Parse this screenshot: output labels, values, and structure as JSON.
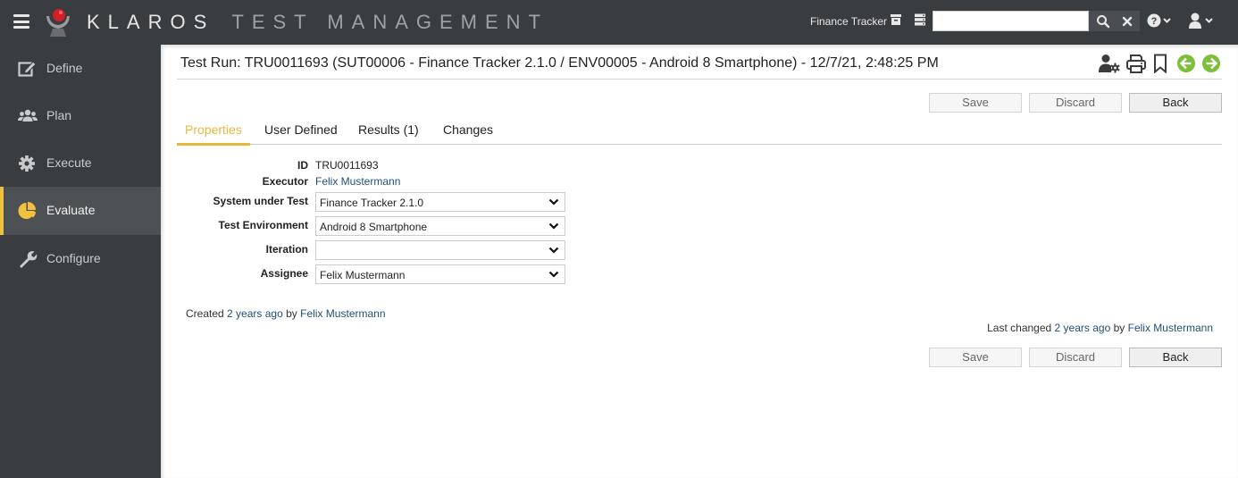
{
  "app": {
    "brand_primary": "KLAROS",
    "brand_secondary": "TEST MANAGEMENT",
    "accent_color": "#f0c040"
  },
  "topbar": {
    "project_name": "Finance Tracker",
    "search": {
      "value": "",
      "placeholder": ""
    },
    "icons": [
      "archive-icon",
      "server-icon",
      "search-icon",
      "clear-icon",
      "help-icon",
      "user-icon"
    ]
  },
  "sidebar": {
    "items": [
      {
        "label": "Define",
        "icon": "edit-icon",
        "active": false
      },
      {
        "label": "Plan",
        "icon": "users-icon",
        "active": false
      },
      {
        "label": "Execute",
        "icon": "gear-icon",
        "active": false
      },
      {
        "label": "Evaluate",
        "icon": "pie-chart-icon",
        "active": true
      },
      {
        "label": "Configure",
        "icon": "wrench-icon",
        "active": false
      }
    ]
  },
  "page": {
    "title": "Test Run: TRU0011693 (SUT00006 - Finance Tracker 2.1.0 / ENV00005 - Android 8 Smartphone) - 12/7/21, 2:48:25 PM",
    "header_icons": [
      "user-settings-icon",
      "print-icon",
      "bookmark-icon",
      "previous-icon",
      "next-icon"
    ]
  },
  "buttons": {
    "save": "Save",
    "discard": "Discard",
    "back": "Back"
  },
  "tabs": [
    {
      "label": "Properties",
      "active": true
    },
    {
      "label": "User Defined",
      "active": false
    },
    {
      "label": "Results (1)",
      "active": false
    },
    {
      "label": "Changes",
      "active": false
    }
  ],
  "form": {
    "id_label": "ID",
    "id_value": "TRU0011693",
    "executor_label": "Executor",
    "executor_value": "Felix Mustermann",
    "sut_label": "System under Test",
    "sut_value": "Finance Tracker 2.1.0",
    "env_label": "Test Environment",
    "env_value": "Android 8 Smartphone",
    "iteration_label": "Iteration",
    "iteration_value": "",
    "assignee_label": "Assignee",
    "assignee_value": "Felix Mustermann"
  },
  "meta": {
    "created_prefix": "Created",
    "created_when": "2 years ago",
    "created_by_word": "by",
    "created_by": "Felix Mustermann",
    "changed_prefix": "Last changed",
    "changed_when": "2 years ago",
    "changed_by_word": "by",
    "changed_by": "Felix Mustermann"
  }
}
